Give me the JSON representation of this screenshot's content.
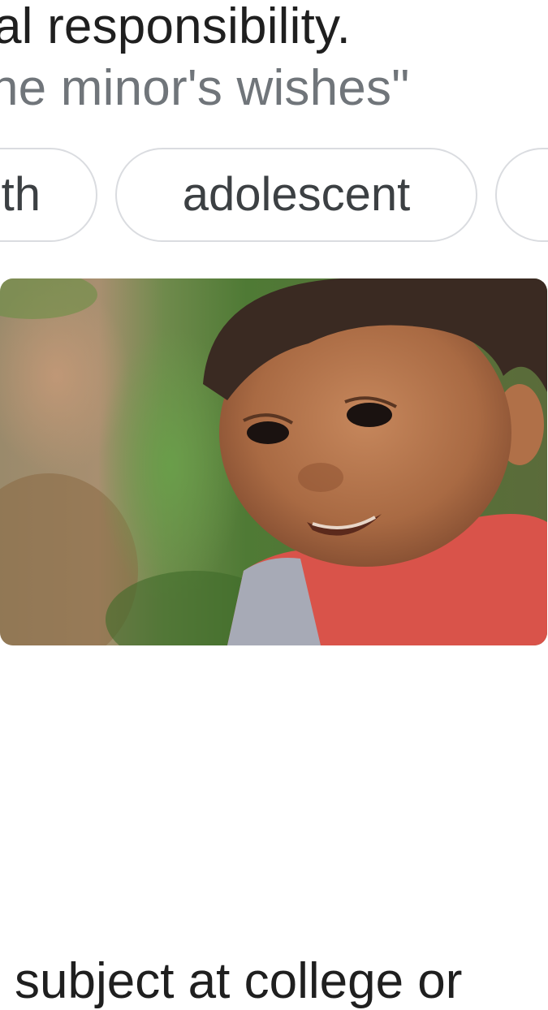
{
  "definition": {
    "text_fragment": "al responsibility."
  },
  "example": {
    "text_fragment": "he minor's wishes\""
  },
  "related_chips": [
    {
      "label": "th"
    },
    {
      "label": "adolescent"
    },
    {
      "label": ""
    }
  ],
  "image": {
    "subject": "young child photo",
    "icon": "photo-thumbnail"
  },
  "next_result": {
    "text_fragment": "subject at college or"
  },
  "colors": {
    "text_primary": "#1f1f1f",
    "text_secondary": "#70757a",
    "chip_border": "#dadce0",
    "chip_text": "#3c4043",
    "background": "#ffffff"
  }
}
